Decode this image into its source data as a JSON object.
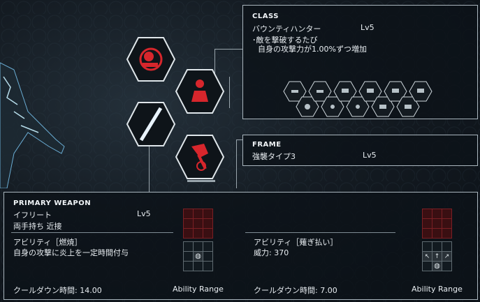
{
  "class_panel": {
    "title": "CLASS",
    "name": "バウンティハンター",
    "level": "Lv5",
    "desc_line1": "･敵を撃破するたび",
    "desc_line2": "自身の攻撃力が1.00%ずつ増加"
  },
  "frame_panel": {
    "title": "FRAME",
    "name": "強襲タイプ3",
    "level": "Lv5"
  },
  "weapon_panel": {
    "title": "PRIMARY WEAPON",
    "name": "イフリート",
    "level": "Lv5",
    "type": "両手持ち 近接",
    "ability1": {
      "label": "アビリティ［燃焼］",
      "desc": "自身の攻撃に炎上を一定時間付与",
      "cooldown": "クールダウン時間: 14.00",
      "range_label": "Ability Range"
    },
    "ability2": {
      "label": "アビリティ［薙ぎ払い］",
      "desc": "威力: 370",
      "cooldown": "クールダウン時間: 7.00",
      "range_label": "Ability Range"
    }
  },
  "hex_icons": [
    "hunter-emblem-icon",
    "character-icon",
    "empty-slot-icon",
    "weapon-axe-icon"
  ],
  "colors": {
    "accent_red": "#d7262c",
    "panel_border": "#aab6be"
  }
}
